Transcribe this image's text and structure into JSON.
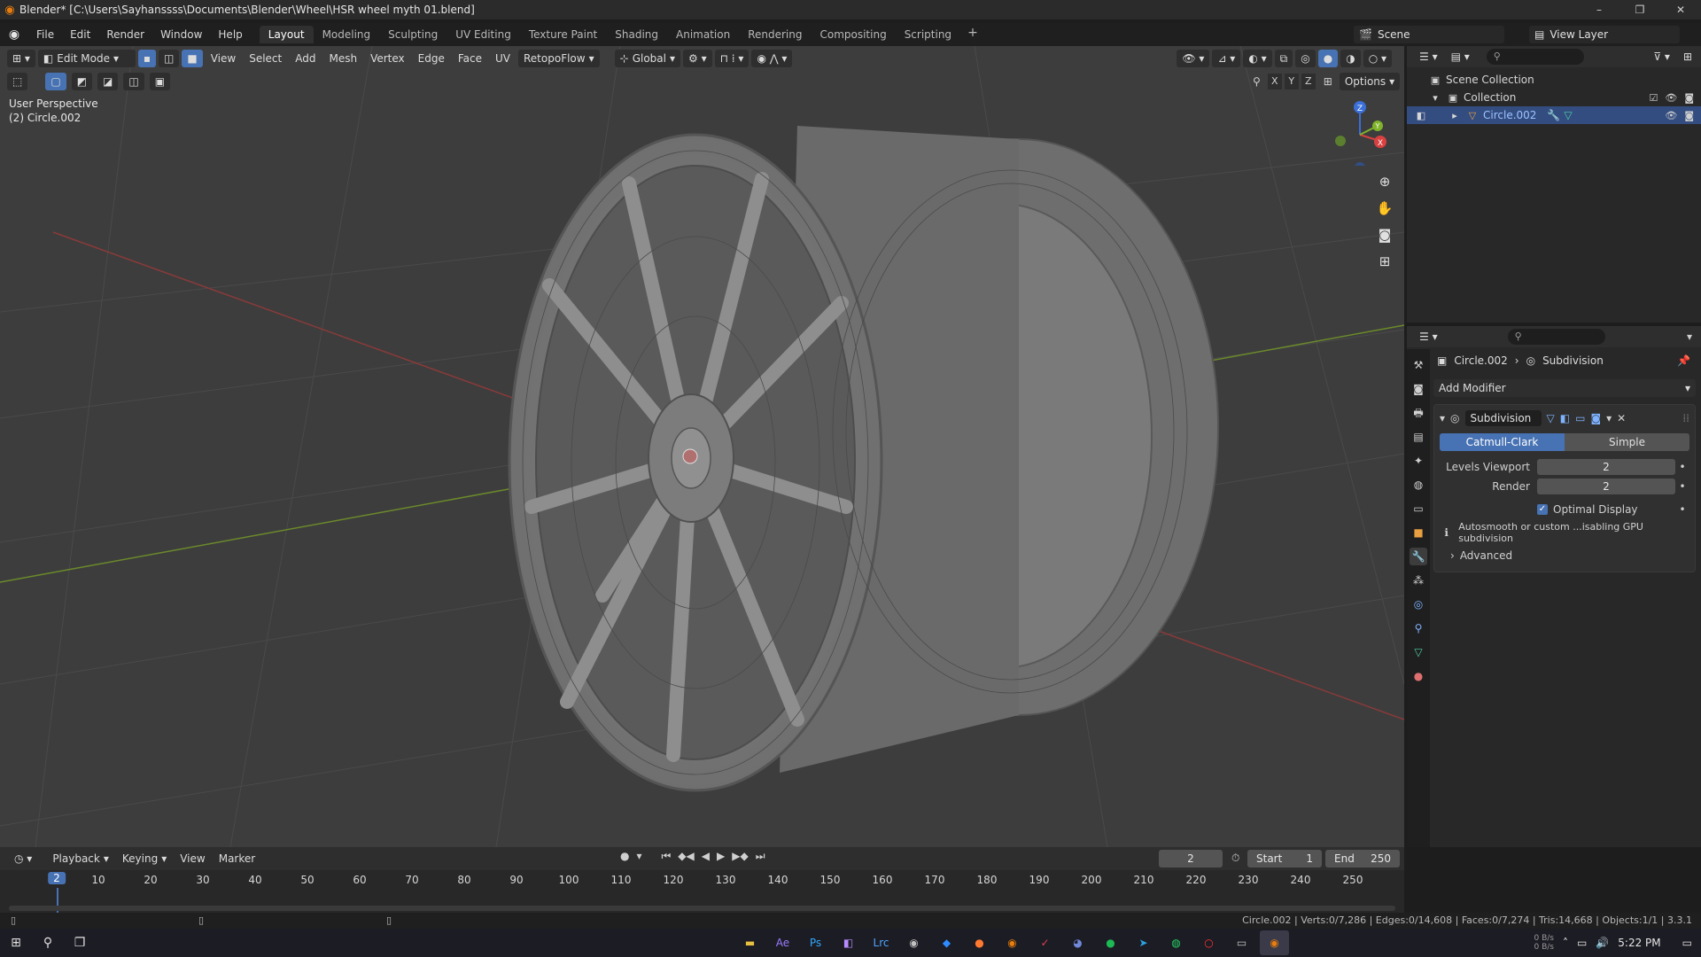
{
  "window": {
    "title": "Blender* [C:\\Users\\Sayhanssss\\Documents\\Blender\\Wheel\\HSR wheel myth 01.blend]",
    "controls": [
      "–",
      "❐",
      "✕"
    ]
  },
  "menubar": {
    "items": [
      "File",
      "Edit",
      "Render",
      "Window",
      "Help"
    ],
    "workspaces": [
      "Layout",
      "Modeling",
      "Sculpting",
      "UV Editing",
      "Texture Paint",
      "Shading",
      "Animation",
      "Rendering",
      "Compositing",
      "Scripting"
    ],
    "active_workspace": "Layout",
    "add_workspace": "+",
    "scene": "Scene",
    "view_layer": "View Layer"
  },
  "viewport": {
    "mode": "Edit Mode",
    "menus": [
      "View",
      "Select",
      "Add",
      "Mesh",
      "Vertex",
      "Edge",
      "Face",
      "UV"
    ],
    "retopo": "RetopoFlow",
    "orientation": "Global",
    "options": "Options",
    "axes": [
      "X",
      "Y",
      "Z"
    ],
    "perspective": "User Perspective",
    "object_label": "(2) Circle.002",
    "gizmo_labels": [
      "X",
      "Y",
      "Z"
    ]
  },
  "outliner": {
    "search_placeholder": "",
    "scene_collection": "Scene Collection",
    "collection": "Collection",
    "object": "Circle.002"
  },
  "properties": {
    "breadcrumb_object": "Circle.002",
    "breadcrumb_modifier": "Subdivision",
    "add_modifier": "Add Modifier",
    "modifier": {
      "name": "Subdivision",
      "types": [
        "Catmull-Clark",
        "Simple"
      ],
      "active_type": "Catmull-Clark",
      "levels_viewport_label": "Levels Viewport",
      "levels_viewport": "2",
      "render_label": "Render",
      "render": "2",
      "optimal_display_label": "Optimal Display",
      "info": "Autosmooth or custom ...isabling GPU subdivision",
      "advanced": "Advanced"
    }
  },
  "timeline": {
    "menus": [
      "Playback",
      "Keying",
      "View",
      "Marker"
    ],
    "current_frame": "2",
    "start_label": "Start",
    "start": "1",
    "end_label": "End",
    "end": "250",
    "ruler": [
      "10",
      "20",
      "30",
      "40",
      "50",
      "60",
      "70",
      "80",
      "90",
      "100",
      "110",
      "120",
      "130",
      "140",
      "150",
      "160",
      "170",
      "180",
      "190",
      "200",
      "210",
      "220",
      "230",
      "240",
      "250"
    ],
    "playhead_label": "2"
  },
  "statusbar": {
    "stats": "Circle.002 | Verts:0/7,286 | Edges:0/14,608 | Faces:0/7,274 | Tris:14,668 | Objects:1/1 | 3.3.1"
  },
  "taskbar": {
    "time": "5:22 PM",
    "net_up": "0 B/s",
    "net_down": "0 B/s"
  }
}
